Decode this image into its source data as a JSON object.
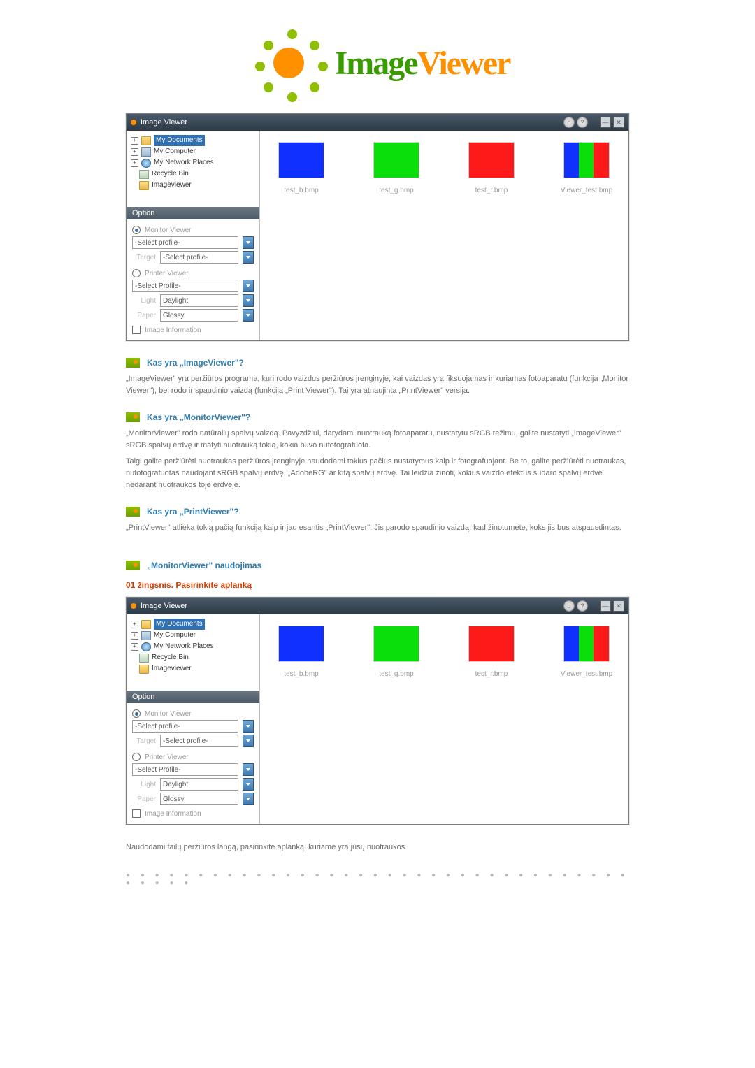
{
  "logo": {
    "text_image": "Image",
    "text_viewer": "Viewer"
  },
  "window": {
    "title": "Image Viewer",
    "tree": {
      "my_documents": "My Documents",
      "my_computer": "My Computer",
      "my_network": "My Network Places",
      "recycle_bin": "Recycle Bin",
      "imageviewer": "Imageviewer"
    },
    "option_header": "Option",
    "monitor_viewer_label": "Monitor Viewer",
    "select_profile": "-Select profile-",
    "target_label": "Target",
    "target_value": "-Select profile-",
    "printer_viewer_label": "Printer Viewer",
    "select_profile_printer": "-Select Profile-",
    "light_label": "Light",
    "light_value": "Daylight",
    "paper_label": "Paper",
    "paper_value": "Glossy",
    "image_info": "Image Information",
    "thumbs": {
      "b": "test_b.bmp",
      "g": "test_g.bmp",
      "r": "test_r.bmp",
      "v": "Viewer_test.bmp"
    },
    "btn_min": "—",
    "btn_close": "✕",
    "btn_home": "⌂",
    "btn_help": "?"
  },
  "sections": {
    "q1_title": "Kas yra „ImageViewer\"?",
    "q1_body": "„ImageViewer\" yra peržiūros programa, kuri rodo vaizdus peržiūros įrenginyje, kai vaizdas yra fiksuojamas ir kuriamas fotoaparatu (funkcija „Monitor Viewer\"), bei rodo ir spaudinio vaizdą (funkcija „Print Viewer\"). Tai yra atnaujinta „PrintViewer\" versija.",
    "q2_title": "Kas yra „MonitorViewer\"?",
    "q2_body_p1": "„MonitorViewer\" rodo natūralių spalvų vaizdą. Pavyzdžiui, darydami nuotrauką fotoaparatu, nustatytu sRGB režimu, galite nustatyti „ImageViewer\" sRGB spalvų erdvę ir matyti nuotrauką tokią, kokia buvo nufotografuota.",
    "q2_body_p2": "Taigi galite peržiūrėti nuotraukas peržiūros įrenginyje naudodami tokius pačius nustatymus kaip ir fotografuojant. Be to, galite peržiūrėti nuotraukas, nufotografuotas naudojant sRGB spalvų erdvę, „AdobeRG\" ar kitą spalvų erdvę. Tai leidžia žinoti, kokius vaizdo efektus sudaro spalvų erdvė nedarant nuotraukos toje erdvėje.",
    "q3_title": "Kas yra „PrintViewer\"?",
    "q3_body": "„PrintViewer\" atlieka tokią pačią funkciją kaip ir jau esantis „PrintViewer\". Jis parodo spaudinio vaizdą, kad žinotumėte, koks jis bus atspausdintas.",
    "usage_title": "„MonitorViewer\" naudojimas",
    "step1": "01 žingsnis. Pasirinkite aplanką",
    "step1_caption": "Naudodami failų peržiūros langą, pasirinkite aplanką, kuriame yra jūsų nuotraukos."
  },
  "dots": "● ● ● ● ● ● ● ● ● ● ● ● ● ● ● ● ● ● ● ● ● ● ● ● ● ● ● ● ● ● ● ● ● ● ● ● ● ● ● ●"
}
